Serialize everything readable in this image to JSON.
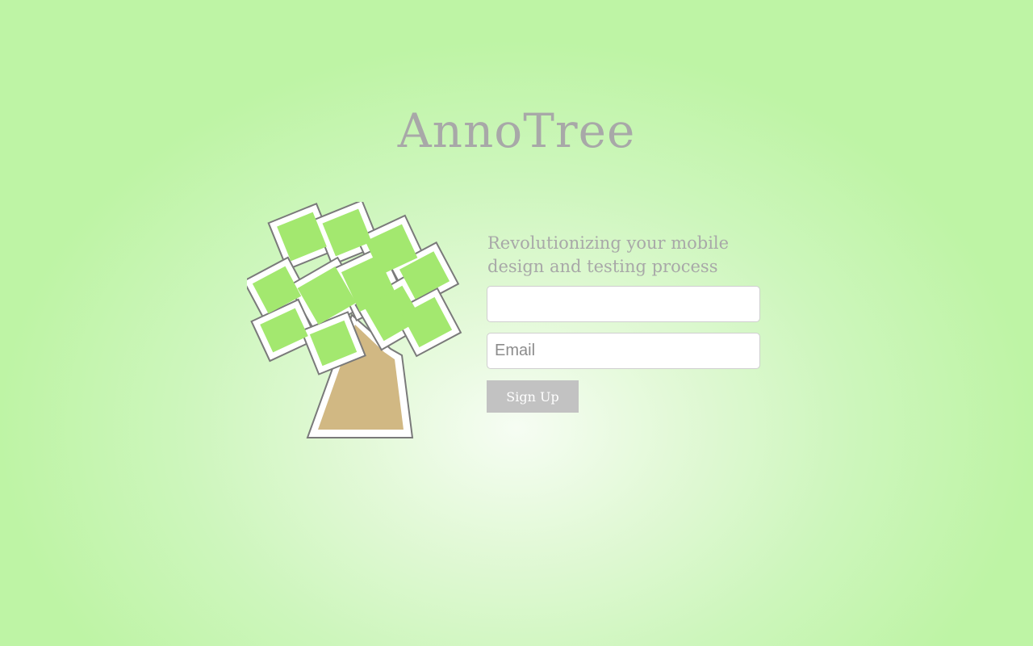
{
  "app": {
    "title": "AnnoTree",
    "tagline": "Revolutionizing your mobile design and testing process"
  },
  "form": {
    "name_field": {
      "value": "",
      "placeholder": ""
    },
    "email_field": {
      "value": "",
      "placeholder": "Email"
    },
    "submit_label": "Sign Up"
  },
  "colors": {
    "background_center": "#f6fdf3",
    "background_edge": "#bef4a5",
    "leaf": "#a3e86f",
    "trunk": "#d1b883",
    "text_muted": "#a8a8a8",
    "button": "#c2c2c2"
  },
  "icons": {
    "logo": "tree-logo"
  }
}
